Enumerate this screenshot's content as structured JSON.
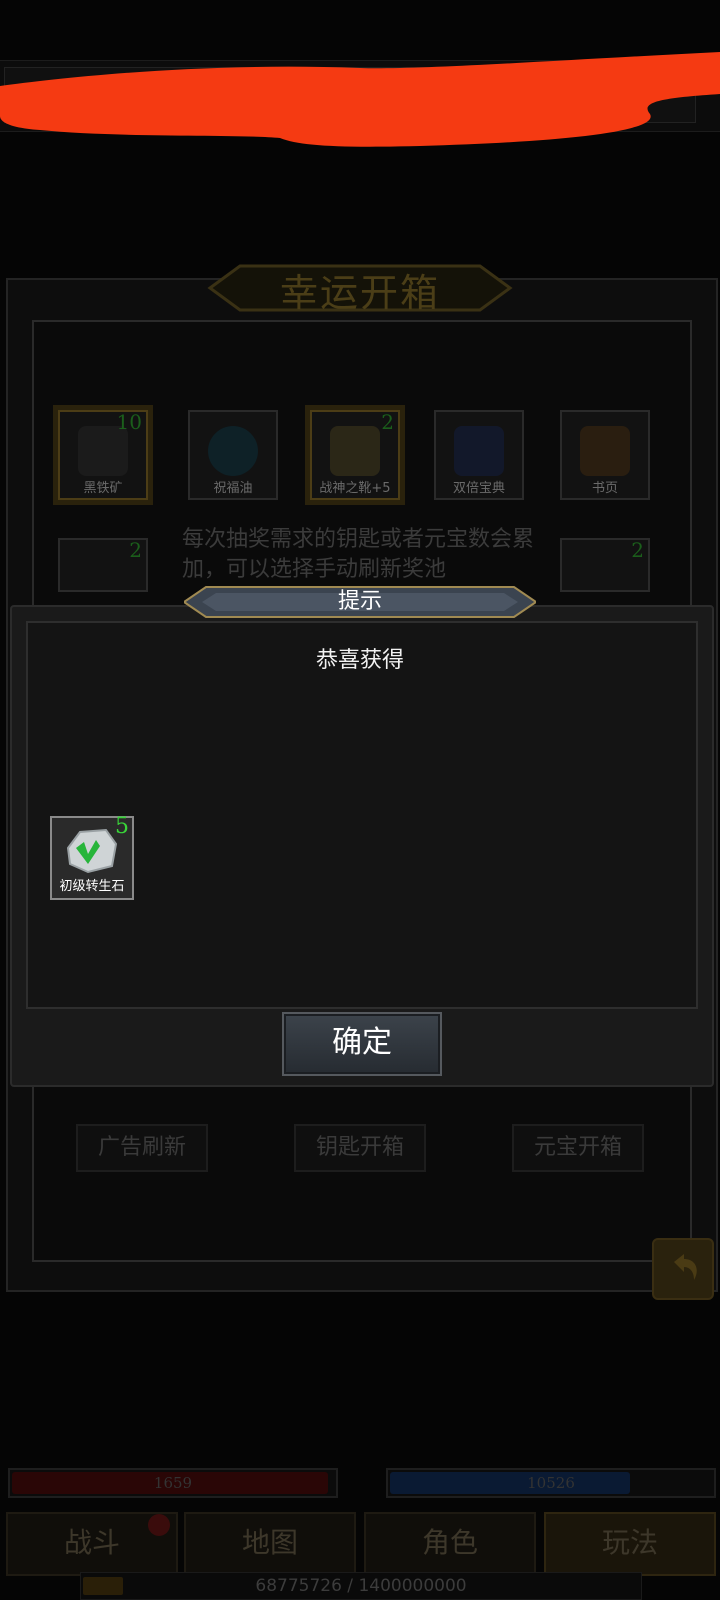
{
  "panel": {
    "title": "幸运开箱",
    "description": "每次抽奖需求的钥匙或者元宝数会累加，可以选择手动刷新奖池",
    "items": [
      {
        "name": "黑铁矿",
        "count": "10",
        "icon": "ore-icon"
      },
      {
        "name": "祝福油",
        "count": "",
        "icon": "potion-icon"
      },
      {
        "name": "战神之靴+5",
        "count": "2",
        "icon": "boots-icon"
      },
      {
        "name": "双倍宝典",
        "count": "",
        "icon": "book-icon"
      },
      {
        "name": "书页",
        "count": "",
        "icon": "pages-icon"
      }
    ],
    "row2_counts": {
      "left": "2",
      "right": "2"
    },
    "buttons": {
      "ad_refresh": "广告刷新",
      "key_open": "钥匙开箱",
      "ingot_open": "元宝开箱"
    }
  },
  "dialog": {
    "title": "提示",
    "subtitle": "恭喜获得",
    "reward": {
      "name": "初级转生石",
      "count": "5",
      "icon": "rebirth-stone-icon"
    },
    "confirm_label": "确定"
  },
  "hud": {
    "hp": "1659",
    "mp": "10526",
    "exp": "68775726 / 1400000000",
    "nav": [
      "战斗",
      "地图",
      "角色",
      "玩法"
    ]
  },
  "colors": {
    "redaction": "#f53a12",
    "reward_count": "#39d439",
    "gold": "#4b3e17"
  }
}
